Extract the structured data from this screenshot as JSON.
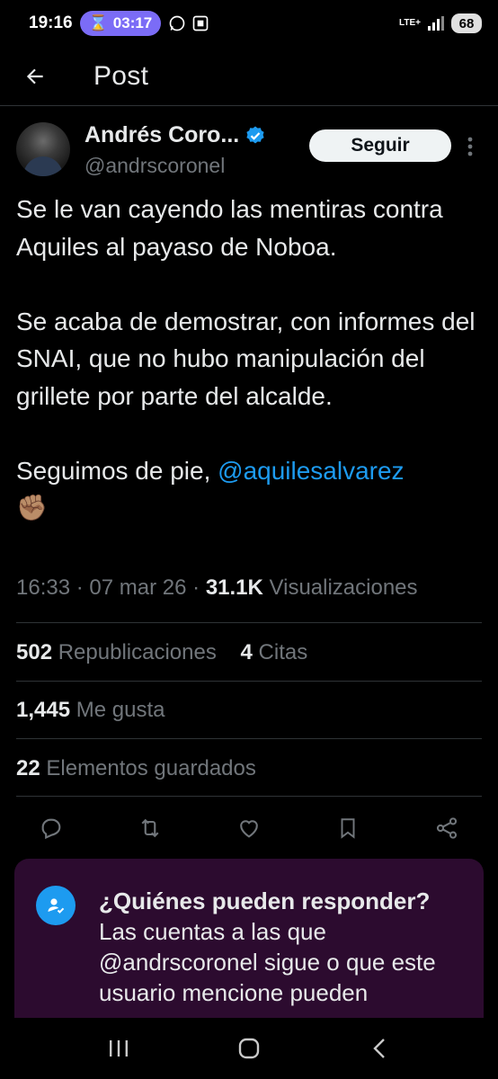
{
  "status_bar": {
    "time": "19:16",
    "timer": "03:17",
    "network": "LTE+",
    "battery": "68"
  },
  "header": {
    "title": "Post"
  },
  "author": {
    "display_name": "Andrés Coro...",
    "handle": "@andrscoronel",
    "follow_label": "Seguir",
    "verified_color": "#1d9bf0"
  },
  "tweet": {
    "paragraph_1": "Se le van cayendo las mentiras contra Aquiles al payaso de Noboa.",
    "paragraph_2": "Se acaba de demostrar, con informes del SNAI, que no hubo manipulación del grillete por parte del alcalde.",
    "paragraph_3_text": "Seguimos de pie, ",
    "mention": "@aquilesalvarez",
    "emoji": "✊🏽"
  },
  "meta": {
    "time": "16:33",
    "date": "07 mar 26",
    "views_count": "31.1K",
    "views_label": "Visualizaciones",
    "separator": "·"
  },
  "stats": {
    "reposts_count": "502",
    "reposts_label": "Republicaciones",
    "quotes_count": "4",
    "quotes_label": "Citas",
    "likes_count": "1,445",
    "likes_label": "Me gusta",
    "bookmarks_count": "22",
    "bookmarks_label": "Elementos guardados"
  },
  "actions": [
    "reply-icon",
    "repost-icon",
    "like-icon",
    "bookmark-icon",
    "share-icon"
  ],
  "reply_card": {
    "title": "¿Quiénes pueden responder?",
    "body": "Las cuentas a las que @andrscoronel sigue o que este usuario mencione pueden"
  },
  "colors": {
    "background": "#000000",
    "accent": "#1d9bf0",
    "muted_text": "#71767b",
    "card_bg": "#2c0b2f"
  }
}
